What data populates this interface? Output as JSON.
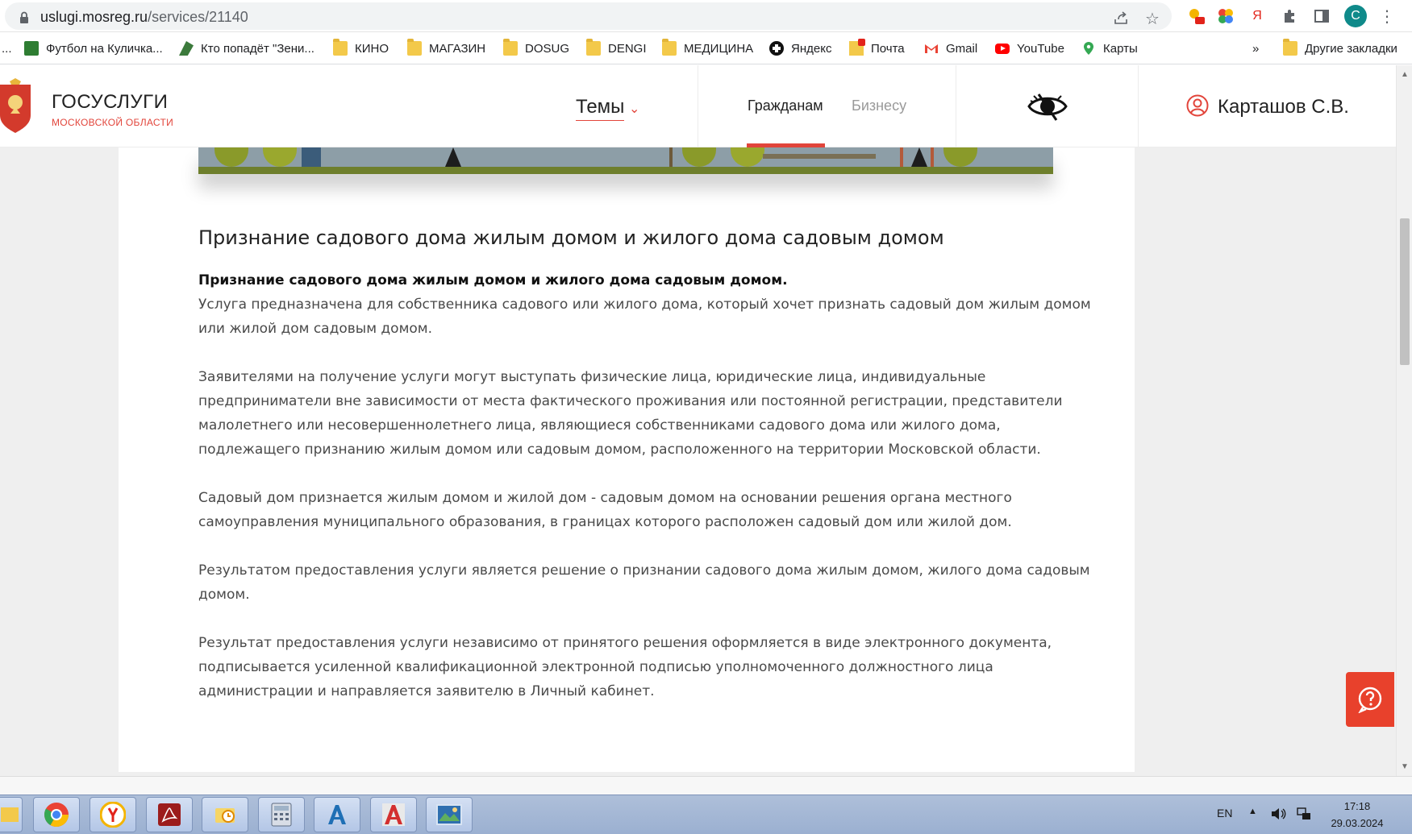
{
  "browser": {
    "url_host": "uslugi.mosreg.ru",
    "url_path": "/services/21140",
    "profile_initial": "C",
    "ya_label": "Я"
  },
  "bookmarks": {
    "ellipsis": "...",
    "items": [
      {
        "label": "Футбол на Куличка...",
        "icon": "football-icon"
      },
      {
        "label": "Кто попадёт \"Зени...",
        "icon": "zenit-icon"
      },
      {
        "label": "КИНО",
        "icon": "folder-icon"
      },
      {
        "label": "МАГАЗИН",
        "icon": "folder-icon"
      },
      {
        "label": "DOSUG",
        "icon": "folder-icon"
      },
      {
        "label": "DENGI",
        "icon": "folder-icon"
      },
      {
        "label": "МЕДИЦИНА",
        "icon": "folder-icon"
      },
      {
        "label": "Яндекс",
        "icon": "yandex-icon"
      },
      {
        "label": "Почта",
        "icon": "mail-icon"
      },
      {
        "label": "Gmail",
        "icon": "gmail-icon"
      },
      {
        "label": "YouTube",
        "icon": "youtube-icon"
      },
      {
        "label": "Карты",
        "icon": "maps-icon"
      }
    ],
    "more": "»",
    "other": "Другие закладки"
  },
  "header": {
    "logo_title": "ГОСУСЛУГИ",
    "logo_subtitle": "МОСКОВСКОЙ ОБЛАСТИ",
    "themes": "Темы",
    "tab_citizens": "Гражданам",
    "tab_business": "Бизнесу",
    "user_name": "Карташов С.В."
  },
  "content": {
    "title": "Признание садового дома жилым домом и жилого дома садовым домом",
    "lead": "Признание садового дома жилым домом и жилого дома садовым домом.",
    "p1": [
      "Услуга предназначена для собственника садового или жилого дома, который хочет признать садовый дом жилым домом",
      "или жилой дом садовым домом."
    ],
    "p2": [
      "Заявителями на получение услуги могут выступать физические лица, юридические лица, индивидуальные",
      "предприниматели вне зависимости от места фактического проживания или постоянной регистрации, представители",
      "малолетнего или несовершеннолетнего лица, являющиеся собственниками садового дома или жилого дома,",
      "подлежащего признанию жилым домом или садовым домом, расположенного на территории Московской области."
    ],
    "p3": [
      "Садовый дом признается жилым домом и жилой дом - садовым домом на основании решения органа местного",
      "самоуправления муниципального образования, в границах которого расположен садовый дом или жилой дом."
    ],
    "p4": [
      "Результатом предоставления услуги является решение о признании садового дома жилым домом, жилого дома садовым",
      "домом."
    ],
    "p5": [
      "Результат предоставления услуги независимо от принятого решения оформляется в виде электронного документа,",
      "подписывается усиленной квалификационной электронной подписью уполномоченного должностного лица",
      "администрации и направляется заявителю в Личный кабинет."
    ]
  },
  "taskbar": {
    "lang": "EN",
    "time": "17:18",
    "date": "29.03.2024",
    "apps": [
      "explorer-icon",
      "chrome-icon",
      "yandex-browser-icon",
      "acrobat-icon",
      "outlook-icon",
      "calculator-icon",
      "autocad-lt-icon",
      "autocad-icon",
      "image-viewer-icon"
    ]
  },
  "colors": {
    "accent": "#e2453b",
    "chat": "#e8412c",
    "hero_green": "#6e7f2c"
  }
}
